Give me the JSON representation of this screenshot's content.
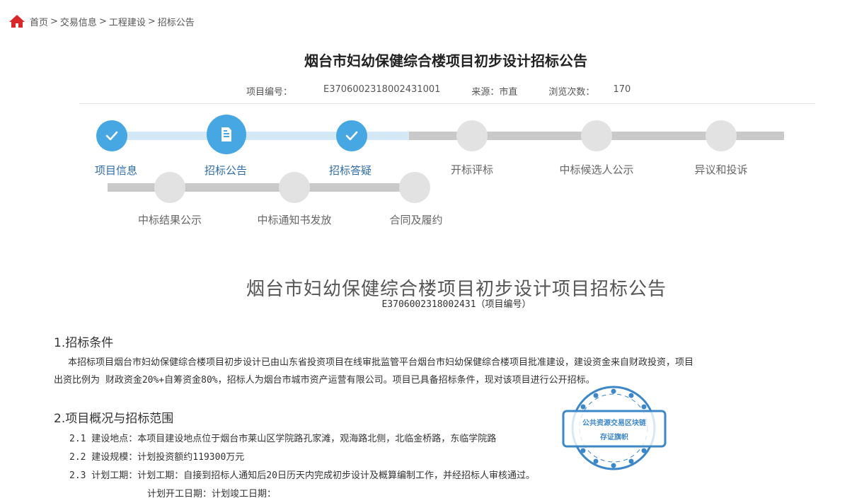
{
  "breadcrumb": {
    "items": [
      "首页",
      "交易信息",
      "工程建设",
      "招标公告"
    ],
    "sep": ">"
  },
  "header": {
    "title": "烟台市妇幼保健综合楼项目初步设计招标公告",
    "project_no_label": "项目编号：",
    "project_no": "E3706002318002431001",
    "source_label": "来源：",
    "source": "市直",
    "views_label": "浏览次数：",
    "views": "170"
  },
  "steps": {
    "row1": [
      "项目信息",
      "招标公告",
      "招标答疑",
      "开标评标",
      "中标候选人公示",
      "异议和投诉"
    ],
    "row2": [
      "中标结果公示",
      "中标通知书发放",
      "合同及履约"
    ]
  },
  "document": {
    "title": "烟台市妇幼保健综合楼项目初步设计项目招标公告",
    "subtitle": "E3706002318002431（项目编号）",
    "section1_title": "1.招标条件",
    "section1_line1": "本招标项目烟台市妇幼保健综合楼项目初步设计已由山东省投资项目在线审批监管平台烟台市妇幼保健综合楼项目批准建设，建设资金来自财政投资，项目",
    "section1_line2": "出资比例为 财政资金20%+自筹资金80%，招标人为烟台市城市资产运营有限公司。项目已具备招标条件，现对该项目进行公开招标。",
    "section2_title": "2.项目概况与招标范围",
    "item_2_1": "2.1 建设地点：本项目建设地点位于烟台市莱山区学院路孔家滩，观海路北侧，北临金桥路，东临学院路",
    "item_2_2": "2.2 建设规模：计划投资额约119300万元",
    "item_2_3": "2.3 计划工期：计划工期：自接到招标人通知后20日历天内完成初步设计及概算编制工作，并经招标人审核通过。",
    "item_2_3b": "计划开工日期：计划竣工日期："
  },
  "badge": {
    "line1": "公共资源交易区块链",
    "line2": "存证旗帜"
  },
  "colors": {
    "accent": "#47a7e2",
    "track_done": "#d4e8f6",
    "track_todo": "#c9c9c9",
    "home": "#d9272a",
    "badge": "#3b87c8"
  },
  "icons": {
    "home": "home-icon",
    "check": "check-icon",
    "document": "document-icon"
  }
}
